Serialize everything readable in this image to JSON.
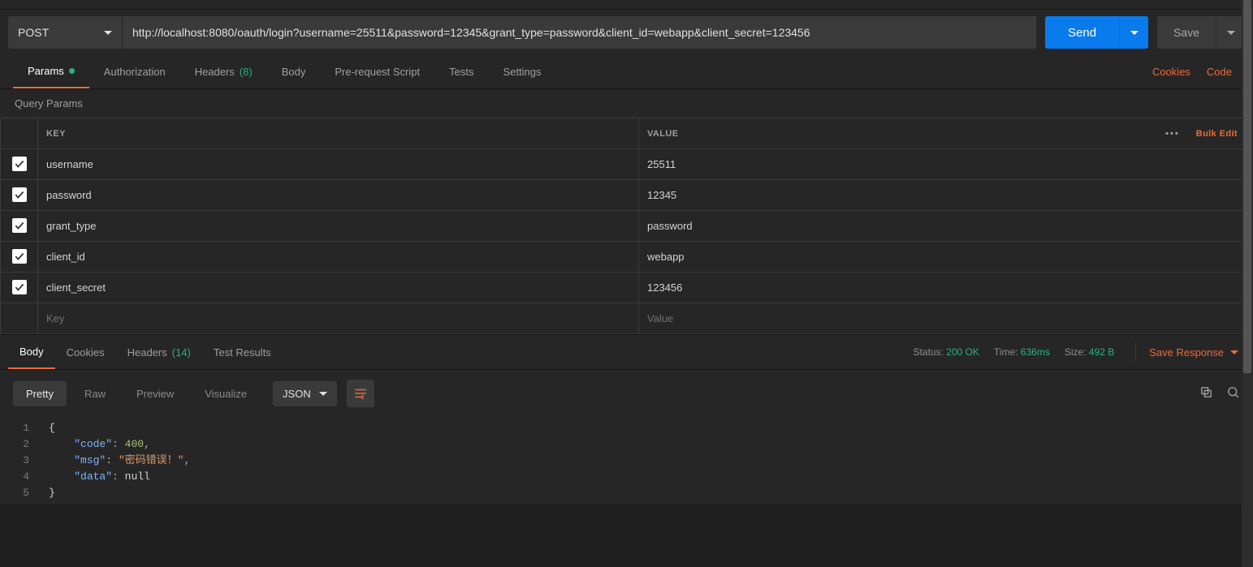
{
  "request": {
    "method": "POST",
    "url": "http://localhost:8080/oauth/login?username=25511&password=12345&grant_type=password&client_id=webapp&client_secret=123456",
    "send_label": "Send",
    "save_label": "Save"
  },
  "req_tabs": {
    "params": "Params",
    "authorization": "Authorization",
    "headers": "Headers",
    "headers_count": "(8)",
    "body": "Body",
    "prerequest": "Pre-request Script",
    "tests": "Tests",
    "settings": "Settings",
    "cookies": "Cookies",
    "code": "Code"
  },
  "query_params": {
    "title": "Query Params",
    "header_key": "KEY",
    "header_value": "VALUE",
    "bulk_edit": "Bulk Edit",
    "rows": [
      {
        "key": "username",
        "value": "25511"
      },
      {
        "key": "password",
        "value": "12345"
      },
      {
        "key": "grant_type",
        "value": "password"
      },
      {
        "key": "client_id",
        "value": "webapp"
      },
      {
        "key": "client_secret",
        "value": "123456"
      }
    ],
    "placeholder_key": "Key",
    "placeholder_value": "Value"
  },
  "resp_tabs": {
    "body": "Body",
    "cookies": "Cookies",
    "headers": "Headers",
    "headers_count": "(14)",
    "tests": "Test Results"
  },
  "resp_meta": {
    "status_label": "Status:",
    "status_value": "200 OK",
    "time_label": "Time:",
    "time_value": "636ms",
    "size_label": "Size:",
    "size_value": "492 B",
    "save_response": "Save Response"
  },
  "body_toolbar": {
    "pretty": "Pretty",
    "raw": "Raw",
    "preview": "Preview",
    "visualize": "Visualize",
    "format": "JSON"
  },
  "response_json": {
    "line1": "{",
    "line2_key": "\"code\"",
    "line2_val": "400",
    "line3_key": "\"msg\"",
    "line3_val": "\"密码错误！\"",
    "line4_key": "\"data\"",
    "line4_val": "null",
    "line5": "}"
  }
}
